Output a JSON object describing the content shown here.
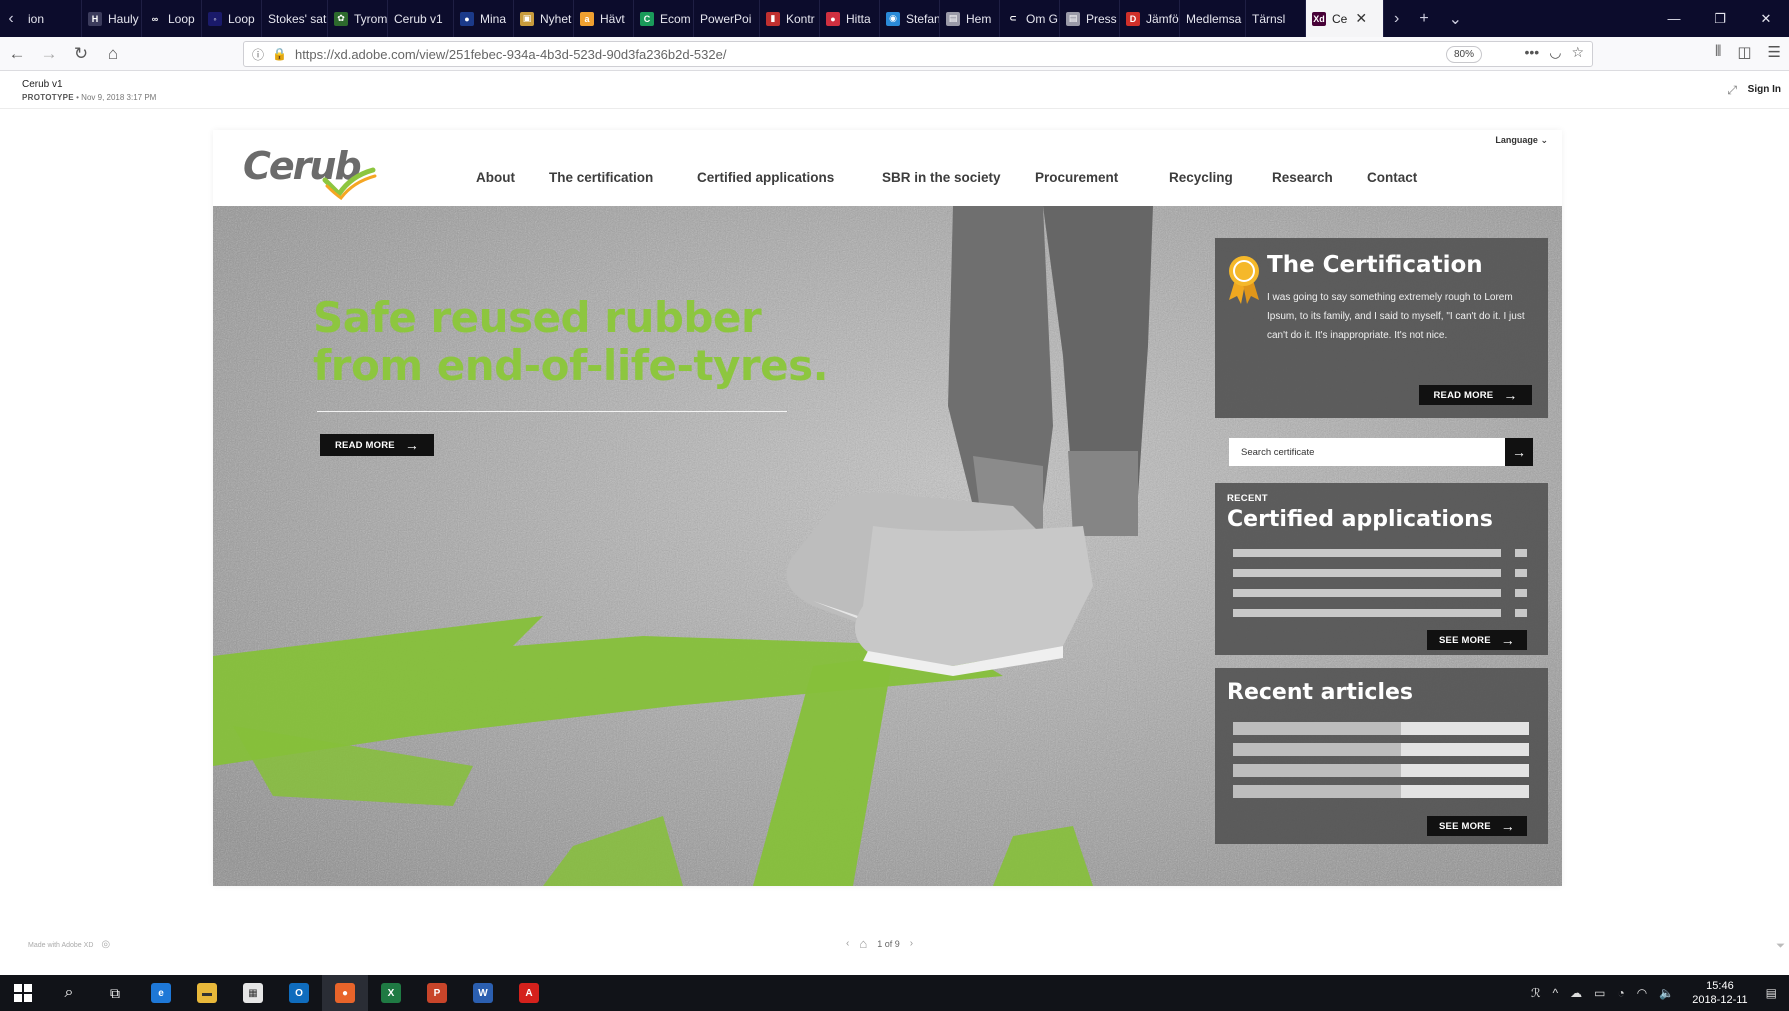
{
  "browser": {
    "tabs": [
      {
        "label": "ion",
        "icon": "",
        "color": "#0c0c2c"
      },
      {
        "label": "Hauly",
        "icon": "H",
        "color": "#3c3c5c"
      },
      {
        "label": "Loop",
        "icon": "∞",
        "color": "#0c0c2c"
      },
      {
        "label": "Loop",
        "icon": "◦",
        "color": "#1a1a6a"
      },
      {
        "label": "Stokes' sat",
        "icon": "",
        "color": "#0c0c2c"
      },
      {
        "label": "Tyrom",
        "icon": "✿",
        "color": "#2d6a2d"
      },
      {
        "label": "Cerub v1",
        "icon": "",
        "color": "#0c0c2c"
      },
      {
        "label": "Mina",
        "icon": "●",
        "color": "#1b3a8a"
      },
      {
        "label": "Nyhet",
        "icon": "▣",
        "color": "#c89b3c"
      },
      {
        "label": "Hävt",
        "icon": "a",
        "color": "#f0a030"
      },
      {
        "label": "Ecom",
        "icon": "C",
        "color": "#1a9a5a"
      },
      {
        "label": "PowerPoi",
        "icon": "",
        "color": "#0c0c2c"
      },
      {
        "label": "Kontr",
        "icon": "▮",
        "color": "#c03030"
      },
      {
        "label": "Hitta",
        "icon": "●",
        "color": "#d03040"
      },
      {
        "label": "Stefan",
        "icon": "◉",
        "color": "#2a8ad8"
      },
      {
        "label": "Hem",
        "icon": "▤",
        "color": "#9a9aa8"
      },
      {
        "label": "Om G",
        "icon": "⊂",
        "color": "#0c0c2c"
      },
      {
        "label": "Press",
        "icon": "▤",
        "color": "#9a9aa8"
      },
      {
        "label": "Jämfö",
        "icon": "D",
        "color": "#d0302a"
      },
      {
        "label": "Medlemsa",
        "icon": "",
        "color": "#0c0c2c"
      },
      {
        "label": "Tärnsl",
        "icon": "",
        "color": "#0c0c2c"
      },
      {
        "label": "Ce",
        "icon": "Xd",
        "color": "#470137",
        "active": true
      }
    ],
    "url": "https://xd.adobe.com/view/251febec-934a-4b3d-523d-90d3fa236b2d-532e/",
    "zoom": "80%"
  },
  "xd": {
    "title": "Cerub v1",
    "prototype_label": "PROTOTYPE",
    "date": "Nov 9, 2018 3:17 PM",
    "sign_in": "Sign In",
    "made_with": "Made with Adobe XD",
    "page_count": "1 of 9"
  },
  "site": {
    "logo": "Cerub",
    "language": "Language",
    "nav": [
      "About",
      "The certification",
      "Certified applications",
      "SBR in the society",
      "Procurement",
      "Recycling",
      "Research",
      "Contact"
    ],
    "hero": {
      "title_line1": "Safe reused rubber",
      "title_line2": "from end-of-life-tyres.",
      "cta": "READ MORE"
    },
    "certification": {
      "title": "The Certification",
      "body": "I was going to say something extremely rough to Lorem Ipsum, to its family, and I said to myself, \"I can't do it. I just can't do it. It's inappropriate. It's not nice.",
      "cta": "READ MORE"
    },
    "search": {
      "placeholder": "Search certificate"
    },
    "applications": {
      "kicker": "RECENT",
      "title": "Certified applications",
      "cta": "SEE MORE"
    },
    "articles": {
      "title": "Recent articles",
      "cta": "SEE MORE"
    },
    "colors": {
      "brand_green": "#8dc63f",
      "panel": "#555555",
      "button": "#111111",
      "logo_grey": "#6b6b6b",
      "check_orange": "#f5a623"
    }
  },
  "taskbar": {
    "apps": [
      {
        "name": "Edge",
        "glyph": "e",
        "color": "#1e78d7"
      },
      {
        "name": "Explorer",
        "glyph": "▬",
        "color": "#e8b83a"
      },
      {
        "name": "Store",
        "glyph": "▦",
        "color": "#e6e6e6"
      },
      {
        "name": "Outlook",
        "glyph": "O",
        "color": "#0f6cbd"
      },
      {
        "name": "Firefox",
        "glyph": "●",
        "color": "#e8642a",
        "active": true
      },
      {
        "name": "Excel",
        "glyph": "X",
        "color": "#1f7a43"
      },
      {
        "name": "PowerPoint",
        "glyph": "P",
        "color": "#c8452a"
      },
      {
        "name": "Word",
        "glyph": "W",
        "color": "#2b5fb0"
      },
      {
        "name": "Acrobat",
        "glyph": "A",
        "color": "#d4211c"
      }
    ],
    "time": "15:46",
    "date": "2018-12-11"
  }
}
